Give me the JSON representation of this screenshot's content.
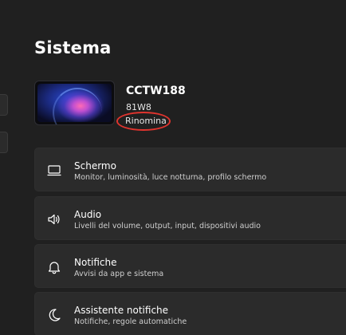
{
  "page": {
    "title": "Sistema"
  },
  "device": {
    "name": "CCTW188",
    "model": "81W8",
    "rename_label": "Rinomina"
  },
  "settings": [
    {
      "title": "Schermo",
      "subtitle": "Monitor, luminosità, luce notturna, profilo schermo",
      "icon": "monitor-icon"
    },
    {
      "title": "Audio",
      "subtitle": "Livelli del volume, output, input, dispositivi audio",
      "icon": "speaker-icon"
    },
    {
      "title": "Notifiche",
      "subtitle": "Avvisi da app e sistema",
      "icon": "bell-icon"
    },
    {
      "title": "Assistente notifiche",
      "subtitle": "Notifiche, regole automatiche",
      "icon": "moon-icon"
    }
  ],
  "colors": {
    "background": "#202020",
    "card": "#2b2b2b",
    "highlight": "#e0342e"
  }
}
